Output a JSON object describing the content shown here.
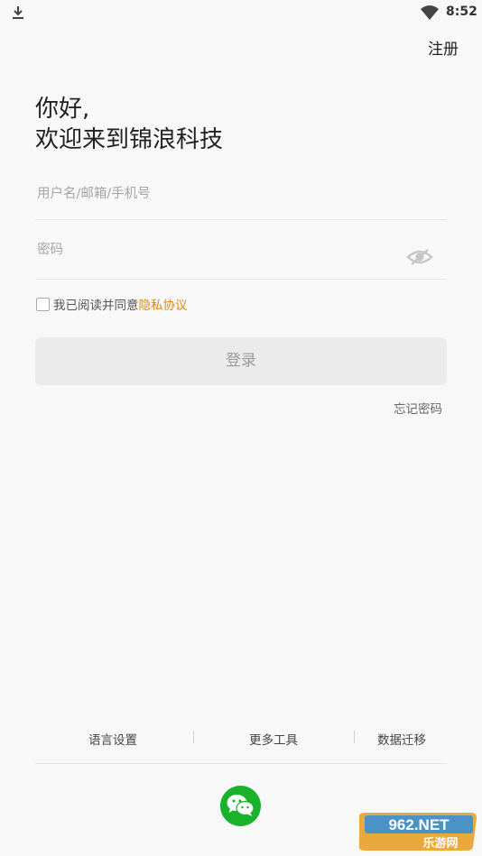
{
  "status_bar": {
    "time": "8:52",
    "left_icon": "download-icon",
    "right_icon": "wifi-icon"
  },
  "header": {
    "register_label": "注册"
  },
  "greeting": {
    "line1": "你好,",
    "line2": "欢迎来到锦浪科技"
  },
  "form": {
    "username_placeholder": "用户名/邮箱/手机号",
    "username_value": "",
    "password_placeholder": "密码",
    "password_value": "",
    "password_visibility_icon": "eye-hidden-icon",
    "agree_checked": false,
    "agree_text": "我已阅读并同意",
    "privacy_link": "隐私协议",
    "login_label": "登录",
    "forgot_label": "忘记密码"
  },
  "bottom": {
    "language_settings": "语言设置",
    "more_tools": "更多工具",
    "data_migration": "数据迁移",
    "social_login_icon": "wechat-icon"
  },
  "watermark": {
    "text_top": "962.NET",
    "text_bottom": "乐游网"
  },
  "colors": {
    "background": "#f8f8f8",
    "accent_link": "#d98a12",
    "wechat_green": "#19b22b",
    "login_button_bg": "#ebebeb",
    "login_button_text": "#9a9a9a"
  }
}
